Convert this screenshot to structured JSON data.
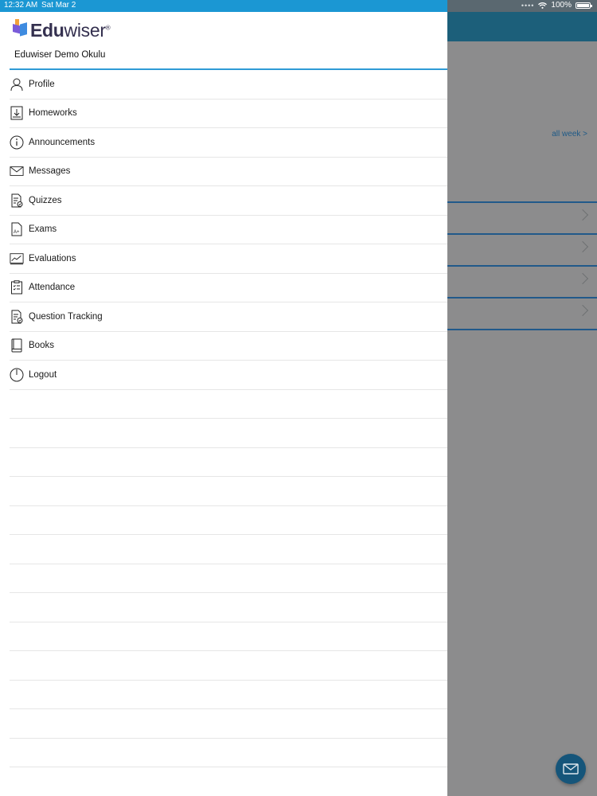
{
  "status_bar": {
    "time": "12:32 AM",
    "date": "Sat Mar 2",
    "battery": "100%"
  },
  "drawer": {
    "logo_text_bold": "Edu",
    "logo_text_light": "wiser",
    "logo_mark": "®",
    "school_name": "Eduwiser Demo Okulu",
    "menu_items": [
      {
        "label": "Profile",
        "icon": "person-icon"
      },
      {
        "label": "Homeworks",
        "icon": "download-box-icon"
      },
      {
        "label": "Announcements",
        "icon": "info-icon"
      },
      {
        "label": "Messages",
        "icon": "envelope-icon"
      },
      {
        "label": "Quizzes",
        "icon": "quiz-document-icon"
      },
      {
        "label": "Exams",
        "icon": "graded-document-icon"
      },
      {
        "label": "Evaluations",
        "icon": "chart-line-icon"
      },
      {
        "label": "Attendance",
        "icon": "clipboard-check-icon"
      },
      {
        "label": "Question Tracking",
        "icon": "question-document-icon"
      },
      {
        "label": "Books",
        "icon": "book-icon"
      },
      {
        "label": "Logout",
        "icon": "power-icon"
      }
    ]
  },
  "main": {
    "all_week_link": "all week >"
  },
  "colors": {
    "accent": "#2f9bd6",
    "status_bar": "#1b97d3",
    "dim_header": "#1c5f7a",
    "fab": "#15557a"
  }
}
